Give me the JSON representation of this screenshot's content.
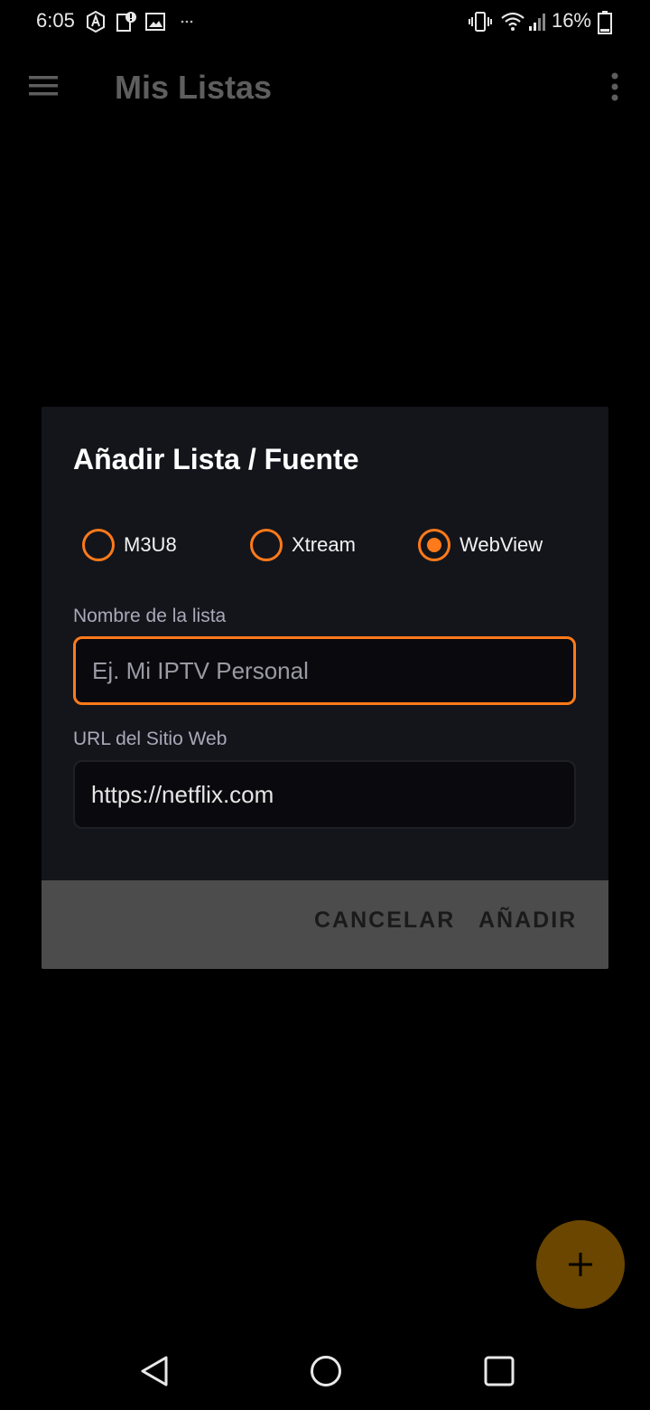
{
  "status_bar": {
    "time": "6:05",
    "battery_percent": "16%"
  },
  "app_bar": {
    "title": "Mis Listas"
  },
  "dialog": {
    "title": "Añadir Lista / Fuente",
    "source_types": [
      {
        "label": "M3U8",
        "selected": false
      },
      {
        "label": "Xtream",
        "selected": false
      },
      {
        "label": "WebView",
        "selected": true
      }
    ],
    "name_field": {
      "label": "Nombre de la lista",
      "value": "",
      "placeholder": "Ej. Mi IPTV Personal"
    },
    "url_field": {
      "label": "URL del Sitio Web",
      "value": "https://netflix.com",
      "placeholder": ""
    },
    "actions": {
      "cancel": "CANCELAR",
      "add": "AÑADIR"
    }
  },
  "fab": {
    "icon": "plus-icon"
  },
  "colors": {
    "accent": "#ff7a1a",
    "dialog_bg": "#14151b",
    "actions_bg": "#4c4c4c",
    "fab_bg": "#6a4600"
  }
}
